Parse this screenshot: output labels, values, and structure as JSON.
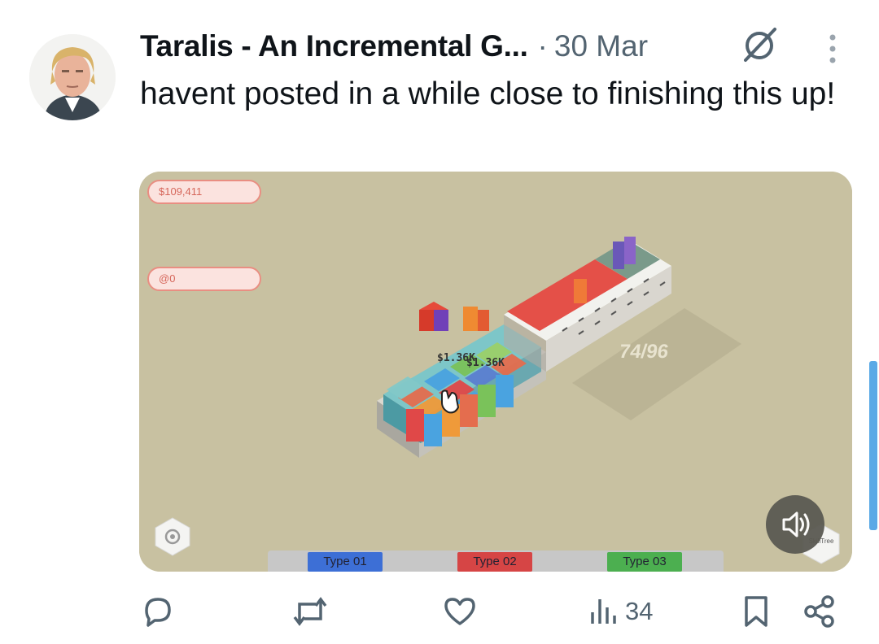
{
  "post": {
    "author": "Taralis - An Incremental G...",
    "separator": "·",
    "date": "30 Mar",
    "text": "havent posted in a while close to finishing this up!"
  },
  "game": {
    "money": "$109,411",
    "gems": "@0",
    "floating_label_1": "$1.36K",
    "floating_label_2": "$1.36K",
    "capacity": "74/96",
    "types": [
      "Type 01",
      "Type 02",
      "Type 03"
    ],
    "type_colors": [
      "#3d6fd6",
      "#d64545",
      "#4caf50"
    ],
    "skill_tree_label": "SkillTree"
  },
  "actions": {
    "views": "34"
  },
  "icons": [
    "grok-icon",
    "more-icon",
    "settings-icon",
    "volume-icon",
    "reply-icon",
    "repost-icon",
    "like-icon",
    "views-icon",
    "bookmark-icon",
    "share-icon"
  ]
}
